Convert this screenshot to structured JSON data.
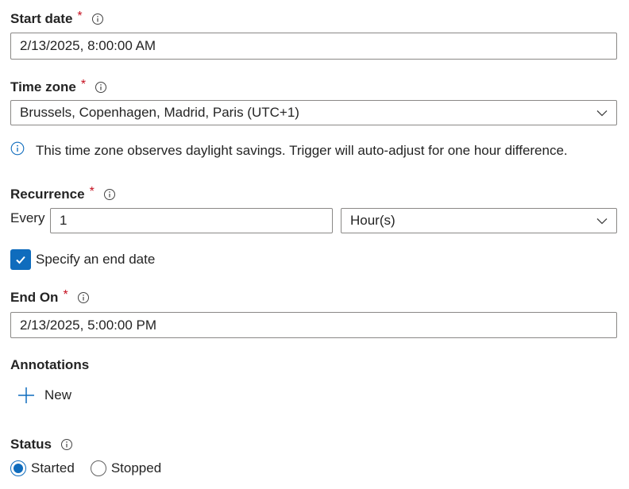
{
  "start_date": {
    "label": "Start date",
    "required_mark": "*",
    "value": "2/13/2025, 8:00:00 AM"
  },
  "time_zone": {
    "label": "Time zone",
    "required_mark": "*",
    "selected": "Brussels, Copenhagen, Madrid, Paris (UTC+1)",
    "info_message": "This time zone observes daylight savings. Trigger will auto-adjust for one hour difference."
  },
  "recurrence": {
    "label": "Recurrence",
    "required_mark": "*",
    "every_label": "Every",
    "interval_value": "1",
    "unit_selected": "Hour(s)"
  },
  "end_date_checkbox": {
    "label": "Specify an end date",
    "checked": true
  },
  "end_on": {
    "label": "End On",
    "required_mark": "*",
    "value": "2/13/2025, 5:00:00 PM"
  },
  "annotations": {
    "label": "Annotations",
    "new_button_label": "New"
  },
  "status": {
    "label": "Status",
    "options": [
      {
        "label": "Started",
        "selected": true
      },
      {
        "label": "Stopped",
        "selected": false
      }
    ]
  },
  "colors": {
    "accent": "#0f6cbd",
    "required": "#c50f1f",
    "border": "#8a8886",
    "text": "#242424"
  },
  "icons": {
    "info": "info-icon",
    "chevron": "chevron-down-icon",
    "check": "checkmark-icon",
    "add": "plus-icon"
  }
}
